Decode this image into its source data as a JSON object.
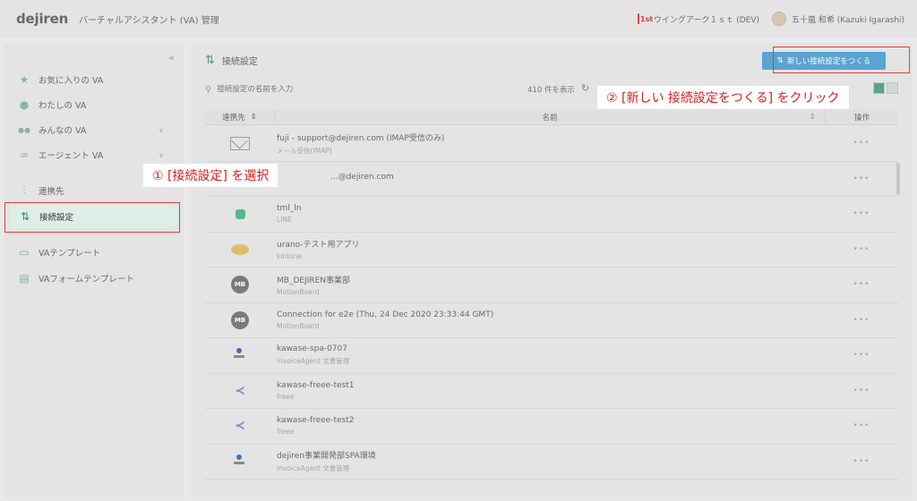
{
  "header": {
    "logo": "dejiren",
    "app_title": "バーチャルアシスタント (VA) 管理",
    "org_name": "ウイングアーク１ｓｔ (DEV)",
    "user_name": "五十嵐 和希 (Kazuki Igarashi)"
  },
  "sidebar": {
    "collapse_glyph": "«",
    "items": [
      {
        "label": "お気に入りの VA",
        "icon": "star-icon",
        "glyph": "★"
      },
      {
        "label": "わたしの VA",
        "icon": "person-icon",
        "glyph": "●"
      },
      {
        "label": "みんなの VA",
        "icon": "people-icon",
        "glyph": "●●",
        "chevron": "∨"
      },
      {
        "label": "エージェント VA",
        "icon": "agent-icon",
        "glyph": "∞",
        "chevron": "∨"
      },
      {
        "label": "連携先",
        "icon": "connector-icon",
        "glyph": "⫶"
      },
      {
        "label": "接続設定",
        "icon": "connection-icon",
        "glyph": "⇅"
      },
      {
        "label": "VAテンプレート",
        "icon": "template-icon",
        "glyph": "▭"
      },
      {
        "label": "VAフォームテンプレート",
        "icon": "form-template-icon",
        "glyph": "▤"
      }
    ]
  },
  "main": {
    "title": "接続設定",
    "new_button_label": "新しい接続設定をつくる",
    "search_placeholder": "接続設定の名前を入力",
    "count_text": "410 件を表示",
    "columns": {
      "connector": "連携先",
      "name": "名前",
      "actions": "操作"
    },
    "rows": [
      {
        "name": "fuji - support@dejiren.com (IMAP受信のみ)",
        "sub": "メール受信(IMAP)",
        "icon": "mail-icon"
      },
      {
        "name": "...@dejiren.com",
        "sub": "",
        "icon": "mail-icon"
      },
      {
        "name": "tml_ln",
        "sub": "LINE",
        "icon": "line-icon"
      },
      {
        "name": "urano-テスト用アプリ",
        "sub": "kintone",
        "icon": "kintone-icon"
      },
      {
        "name": "MB_DEJIREN事業部",
        "sub": "MotionBoard",
        "icon": "motionboard-icon"
      },
      {
        "name": "Connection for e2e (Thu, 24 Dec 2020 23:33:44 GMT)",
        "sub": "MotionBoard",
        "icon": "motionboard-icon"
      },
      {
        "name": "kawase-spa-0707",
        "sub": "invoiceAgent 文書管理",
        "icon": "invoiceagent-icon"
      },
      {
        "name": "kawase-freee-test1",
        "sub": "freee",
        "icon": "freee-icon"
      },
      {
        "name": "kawase-freee-test2",
        "sub": "freee",
        "icon": "freee-icon"
      },
      {
        "name": "dejiren事業開発部SPA環境",
        "sub": "invoiceAgent 文書管理",
        "icon": "invoiceagent-icon"
      }
    ],
    "row_action": "•••",
    "mb_label": "MB"
  },
  "annotations": {
    "step1": "① [接続設定] を選択",
    "step2": "② [新しい 接続設定をつくる] をクリック"
  },
  "colors": {
    "accent": "#5aa3d2",
    "active": "#2d8a64",
    "annotation": "#e23b3b"
  }
}
